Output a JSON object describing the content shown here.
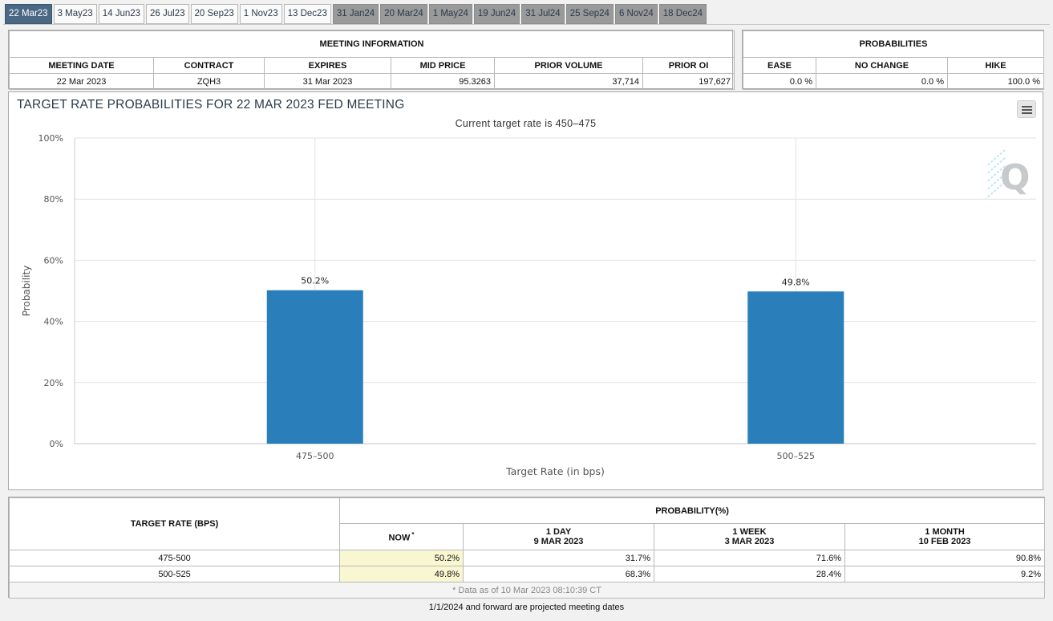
{
  "tabs": [
    {
      "label": "22 Mar23",
      "state": "active"
    },
    {
      "label": "3 May23",
      "state": "normal"
    },
    {
      "label": "14 Jun23",
      "state": "normal"
    },
    {
      "label": "26 Jul23",
      "state": "normal"
    },
    {
      "label": "20 Sep23",
      "state": "normal"
    },
    {
      "label": "1 Nov23",
      "state": "normal"
    },
    {
      "label": "13 Dec23",
      "state": "normal"
    },
    {
      "label": "31 Jan24",
      "state": "projected"
    },
    {
      "label": "20 Mar24",
      "state": "projected"
    },
    {
      "label": "1 May24",
      "state": "projected"
    },
    {
      "label": "19 Jun24",
      "state": "projected"
    },
    {
      "label": "31 Jul24",
      "state": "projected"
    },
    {
      "label": "25 Sep24",
      "state": "projected"
    },
    {
      "label": "6 Nov24",
      "state": "projected"
    },
    {
      "label": "18 Dec24",
      "state": "projected"
    }
  ],
  "meeting_info": {
    "title": "MEETING INFORMATION",
    "headers": [
      "MEETING DATE",
      "CONTRACT",
      "EXPIRES",
      "MID PRICE",
      "PRIOR VOLUME",
      "PRIOR OI"
    ],
    "values": [
      "22 Mar 2023",
      "ZQH3",
      "31 Mar 2023",
      "95.3263",
      "37,714",
      "197,627"
    ]
  },
  "probabilities": {
    "title": "PROBABILITIES",
    "headers": [
      "EASE",
      "NO CHANGE",
      "HIKE"
    ],
    "values": [
      "0.0 %",
      "0.0 %",
      "100.0 %"
    ]
  },
  "chart": {
    "title": "TARGET RATE PROBABILITIES FOR 22 MAR 2023 FED MEETING",
    "subtitle": "Current target rate is 450–475",
    "menu_icon": "hamburger-menu-icon",
    "watermark_icon": "quikstrike-logo-icon",
    "watermark_text": "Q"
  },
  "chart_data": {
    "type": "bar",
    "categories": [
      "475–500",
      "500–525"
    ],
    "values": [
      50.2,
      49.8
    ],
    "data_labels": [
      "50.2%",
      "49.8%"
    ],
    "xlabel": "Target Rate (in bps)",
    "ylabel": "Probability",
    "ylim": [
      0,
      100
    ],
    "yticks": [
      "0%",
      "20%",
      "40%",
      "60%",
      "80%",
      "100%"
    ],
    "grid": true,
    "bar_color": "#2a7fba"
  },
  "prob_table": {
    "col_target": "TARGET RATE (BPS)",
    "col_group": "PROBABILITY(%)",
    "col_now": "NOW",
    "now_mark": "*",
    "col_1day": [
      "1 DAY",
      "9 MAR 2023"
    ],
    "col_1week": [
      "1 WEEK",
      "3 MAR 2023"
    ],
    "col_1month": [
      "1 MONTH",
      "10 FEB 2023"
    ],
    "rows": [
      {
        "rate": "475-500",
        "now": "50.2%",
        "day": "31.7%",
        "week": "71.6%",
        "month": "90.8%"
      },
      {
        "rate": "500-525",
        "now": "49.8%",
        "day": "68.3%",
        "week": "28.4%",
        "month": "9.2%"
      }
    ],
    "note": "* Data as of 10 Mar 2023 08:10:39 CT"
  },
  "footer": "1/1/2024 and forward are projected meeting dates"
}
